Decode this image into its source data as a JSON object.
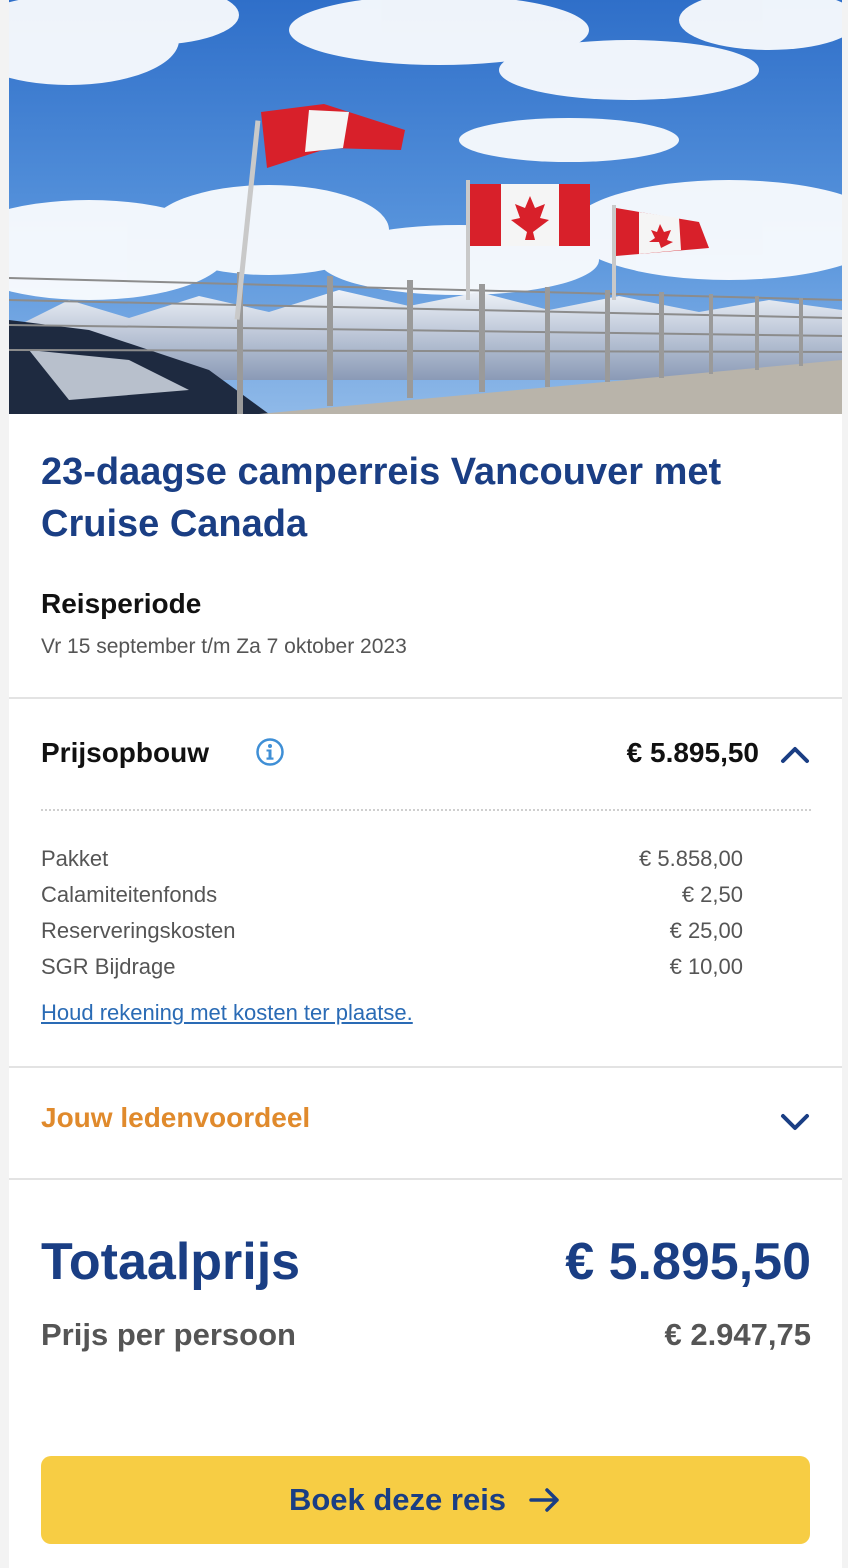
{
  "hero": {
    "image_alt": "Canadese vlaggen bij bergpanorama"
  },
  "trip": {
    "title": "23-daagse camperreis Vancouver met Cruise Canada",
    "period_label": "Reisperiode",
    "period_value": "Vr 15 september t/m Za 7 oktober 2023"
  },
  "price": {
    "header_label": "Prijsopbouw",
    "header_amount": "€ 5.895,50",
    "breakdown": [
      {
        "label": "Pakket",
        "value": "€ 5.858,00"
      },
      {
        "label": "Calamiteitenfonds",
        "value": "€ 2,50"
      },
      {
        "label": "Reserveringskosten",
        "value": "€ 25,00"
      },
      {
        "label": "SGR Bijdrage",
        "value": "€ 10,00"
      }
    ],
    "local_costs_link": "Houd rekening met kosten ter plaatse."
  },
  "member": {
    "label": "Jouw ledenvoordeel"
  },
  "total": {
    "label": "Totaalprijs",
    "value": "€ 5.895,50",
    "per_person_label": "Prijs per persoon",
    "per_person_value": "€ 2.947,75"
  },
  "cta": {
    "label": "Boek deze reis"
  },
  "colors": {
    "brand_blue": "#1a3e84",
    "accent_orange": "#e08a2c",
    "cta_yellow": "#f7cd44",
    "link_blue": "#2a6bb5"
  }
}
